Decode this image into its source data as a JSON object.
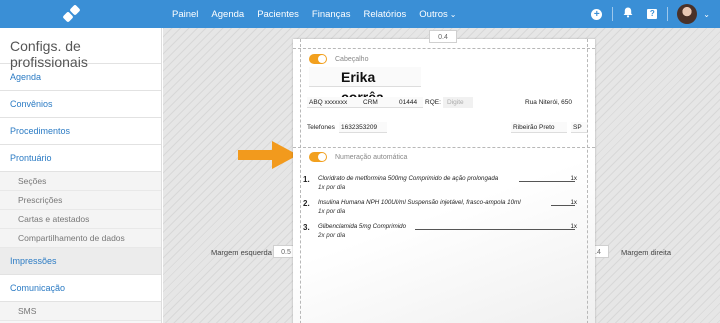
{
  "navbar": {
    "items": [
      "Painel",
      "Agenda",
      "Pacientes",
      "Finanças",
      "Relatórios",
      "Outros"
    ],
    "outros_caret": "⌄",
    "icons": [
      "plus-icon",
      "bell-icon",
      "help-icon"
    ],
    "help_glyph": "?",
    "avatar_caret": "⌄"
  },
  "sidebar": {
    "title": "Configs. de profissionais",
    "items": [
      {
        "label": "Agenda"
      },
      {
        "label": "Convênios"
      },
      {
        "label": "Procedimentos"
      },
      {
        "label": "Prontuário"
      }
    ],
    "prontuario_sub": [
      "Seções",
      "Prescrições",
      "Cartas e atestados",
      "Compartilhamento de dados"
    ],
    "impressoes": "Impressões",
    "comunicacao": "Comunicação",
    "comunicacao_sub": [
      "SMS"
    ]
  },
  "layout_editor": {
    "margin_top": "0.4",
    "margin_left_label": "Margem esquerda",
    "margin_left_value": "0.5",
    "margin_right_label": "Margem direita",
    "margin_right_value": "0.4",
    "header_toggle_label": "Cabeçalho",
    "header_enabled": true,
    "numbering_toggle_label": "Numeração automática",
    "numbering_enabled": true
  },
  "header": {
    "doctor_name": "Erika corrêa",
    "abq": "ABQ xxxxxxx",
    "crm_label": "CRM",
    "crm_value": "01444",
    "rqe_label": "RQE:",
    "rqe_placeholder": "Digite",
    "address": "Rua Niterói, 650",
    "phone_label": "Telefones",
    "phone_value": "1632353209",
    "city": "Ribeirão Preto",
    "state": "SP"
  },
  "prescriptions": [
    {
      "number": "1.",
      "name": "Cloridrato de metformina 500mg Comprimido de ação prolongada",
      "qty": "1x",
      "dose": "1x por dia"
    },
    {
      "number": "2.",
      "name": "Insulina Humana NPH 100UI/ml Suspensão injetável, frasco-ampola 10ml",
      "qty": "1x",
      "dose": "1x por dia"
    },
    {
      "number": "3.",
      "name": "Glibenclamida 5mg Comprimido",
      "qty": "1x",
      "dose": "2x por dia"
    }
  ],
  "colors": {
    "nav": "#3a8fd6",
    "toggle": "#f2a01e",
    "arrow": "#f29a1d",
    "link": "#2b7bc4"
  }
}
